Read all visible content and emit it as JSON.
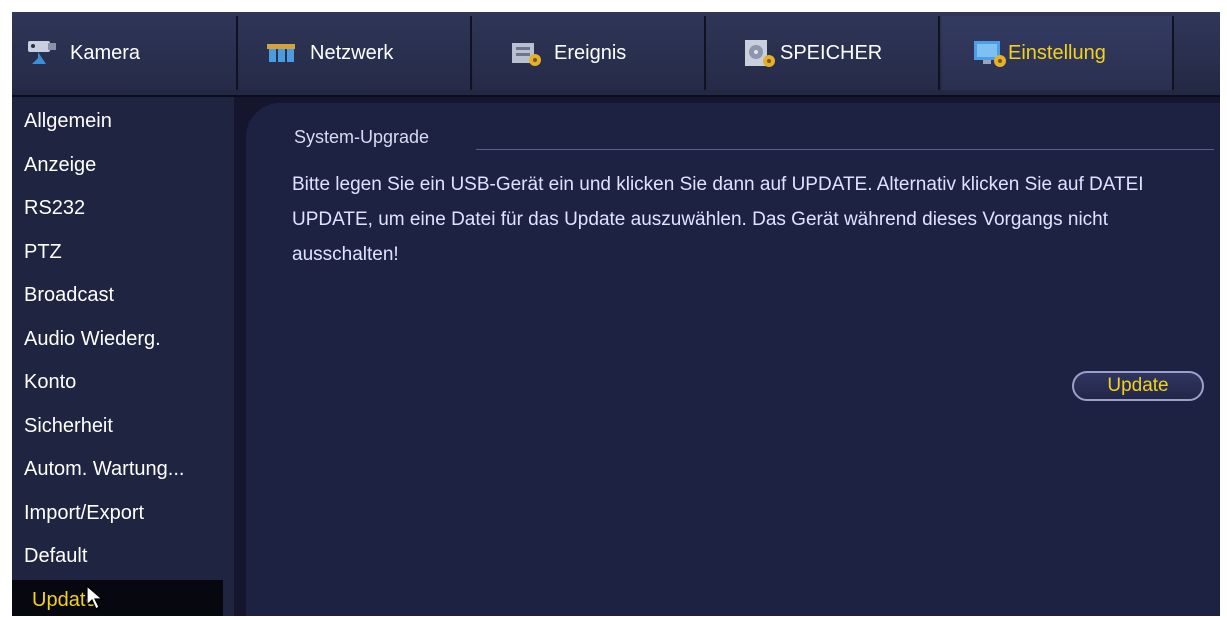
{
  "tabs": [
    {
      "label": "Kamera",
      "icon": "camera-icon",
      "active": false
    },
    {
      "label": "Netzwerk",
      "icon": "network-icon",
      "active": false
    },
    {
      "label": "Ereignis",
      "icon": "event-icon",
      "active": false
    },
    {
      "label": "SPEICHER",
      "icon": "storage-icon",
      "active": false
    },
    {
      "label": "Einstellung",
      "icon": "settings-icon",
      "active": true
    }
  ],
  "sidebar": {
    "items": [
      {
        "label": "Allgemein"
      },
      {
        "label": "Anzeige"
      },
      {
        "label": "RS232"
      },
      {
        "label": "PTZ"
      },
      {
        "label": "Broadcast"
      },
      {
        "label": "Audio Wiederg."
      },
      {
        "label": "Konto"
      },
      {
        "label": "Sicherheit"
      },
      {
        "label": "Autom. Wartung..."
      },
      {
        "label": "Import/Export"
      },
      {
        "label": "Default"
      },
      {
        "label": "Update",
        "active": true
      }
    ]
  },
  "main": {
    "section_title": "System-Upgrade",
    "description": "Bitte legen Sie ein USB-Gerät ein und klicken Sie dann auf UPDATE. Alternativ klicken Sie auf DATEI UPDATE, um eine Datei für das Update auszuwählen. Das Gerät während dieses Vorgangs nicht ausschalten!",
    "update_button": "Update"
  },
  "colors": {
    "accent_text": "#f2d21b",
    "panel_bg": "#1d2142",
    "sidebar_bg": "#1f2440",
    "frame_bg": "#15162e"
  }
}
